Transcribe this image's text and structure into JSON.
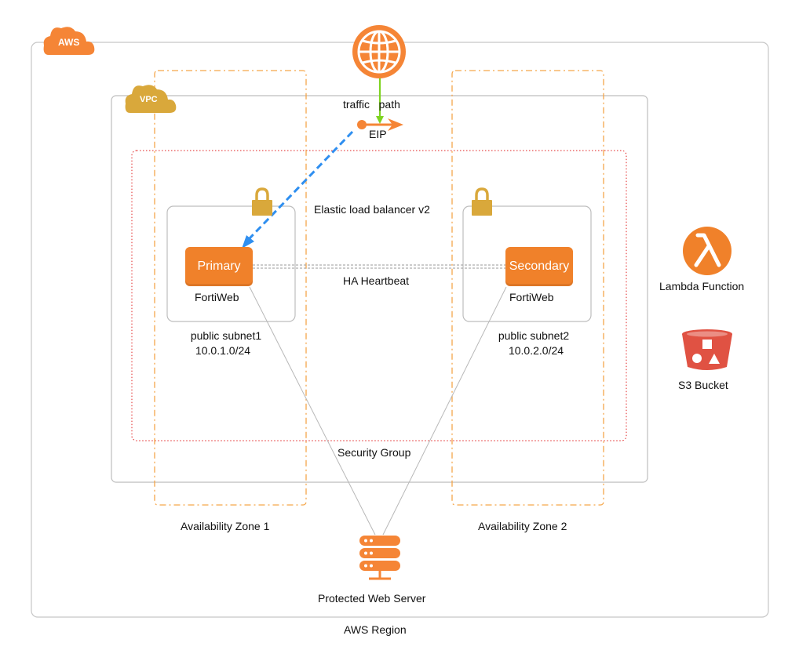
{
  "badges": {
    "aws": "AWS",
    "vpc": "VPC"
  },
  "labels": {
    "traffic_path": "traffic   path",
    "eip": "EIP",
    "elb": "Elastic load balancer v2",
    "ha_heartbeat": "HA Heartbeat",
    "security_group": "Security Group",
    "aws_region": "AWS Region",
    "az1": "Availability Zone 1",
    "az2": "Availability Zone 2",
    "protected_web_server": "Protected Web Server",
    "lambda": "Lambda Function",
    "s3": "S3 Bucket"
  },
  "subnet1": {
    "node_label": "Primary",
    "product": "FortiWeb",
    "name": "public subnet1",
    "cidr": "10.0.1.0/24"
  },
  "subnet2": {
    "node_label": "Secondary",
    "product": "FortiWeb",
    "name": "public subnet2",
    "cidr": "10.0.2.0/24"
  },
  "colors": {
    "orange": "#f58536",
    "node_orange": "#f0812a",
    "lock_gold": "#d9a83b",
    "vpc_gold": "#d9a83b",
    "lambda_orange": "#f0812a",
    "s3_red": "#e05243",
    "traffic_green": "#7ed321",
    "eip_blue": "#2f8ff0",
    "security_group_red": "#e02020",
    "az_border": "#f5a64a",
    "line_gray": "#b8b8b8"
  }
}
